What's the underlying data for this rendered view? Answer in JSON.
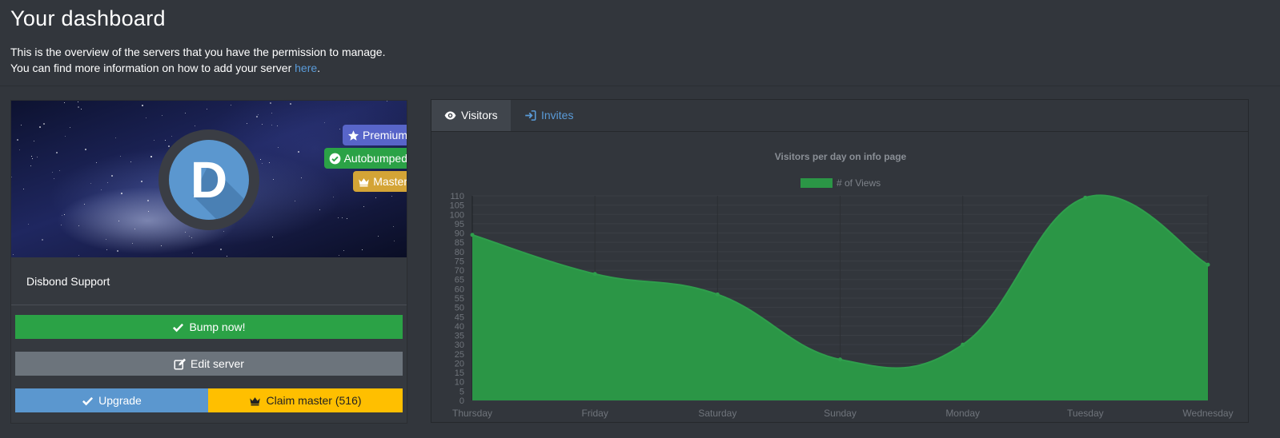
{
  "header": {
    "title": "Your dashboard",
    "intro_line1": "This is the overview of the servers that you have the permission to manage.",
    "intro_line2": "You can find more information on how to add your server ",
    "intro_link": "here",
    "intro_end": "."
  },
  "server": {
    "name": "Disbond Support",
    "avatar_letter": "D",
    "badges": {
      "premium": "Premium",
      "autobumped": "Autobumped",
      "master": "Master"
    },
    "buttons": {
      "bump": "Bump now!",
      "edit": "Edit server",
      "upgrade": "Upgrade",
      "claim": "Claim master (516)"
    }
  },
  "tabs": {
    "visitors": "Visitors",
    "invites": "Invites"
  },
  "colors": {
    "accent": "#5a9bd8",
    "success": "#2ba246",
    "premium": "#5865c9",
    "master": "#d4a436",
    "claim": "#ffbf00"
  },
  "chart_data": {
    "type": "area",
    "title": "Visitors per day on info page",
    "series": [
      {
        "name": "# of Views",
        "values": [
          89,
          68,
          57,
          22,
          30,
          109,
          73
        ],
        "color": "#2b9646"
      }
    ],
    "categories": [
      "Thursday",
      "Friday",
      "Saturday",
      "Sunday",
      "Monday",
      "Tuesday",
      "Wednesday"
    ],
    "ylim": [
      0,
      110
    ],
    "yticks": [
      0,
      5,
      10,
      15,
      20,
      25,
      30,
      35,
      40,
      45,
      50,
      55,
      60,
      65,
      70,
      75,
      80,
      85,
      90,
      95,
      100,
      105,
      110
    ],
    "legend": "top",
    "grid": true
  }
}
